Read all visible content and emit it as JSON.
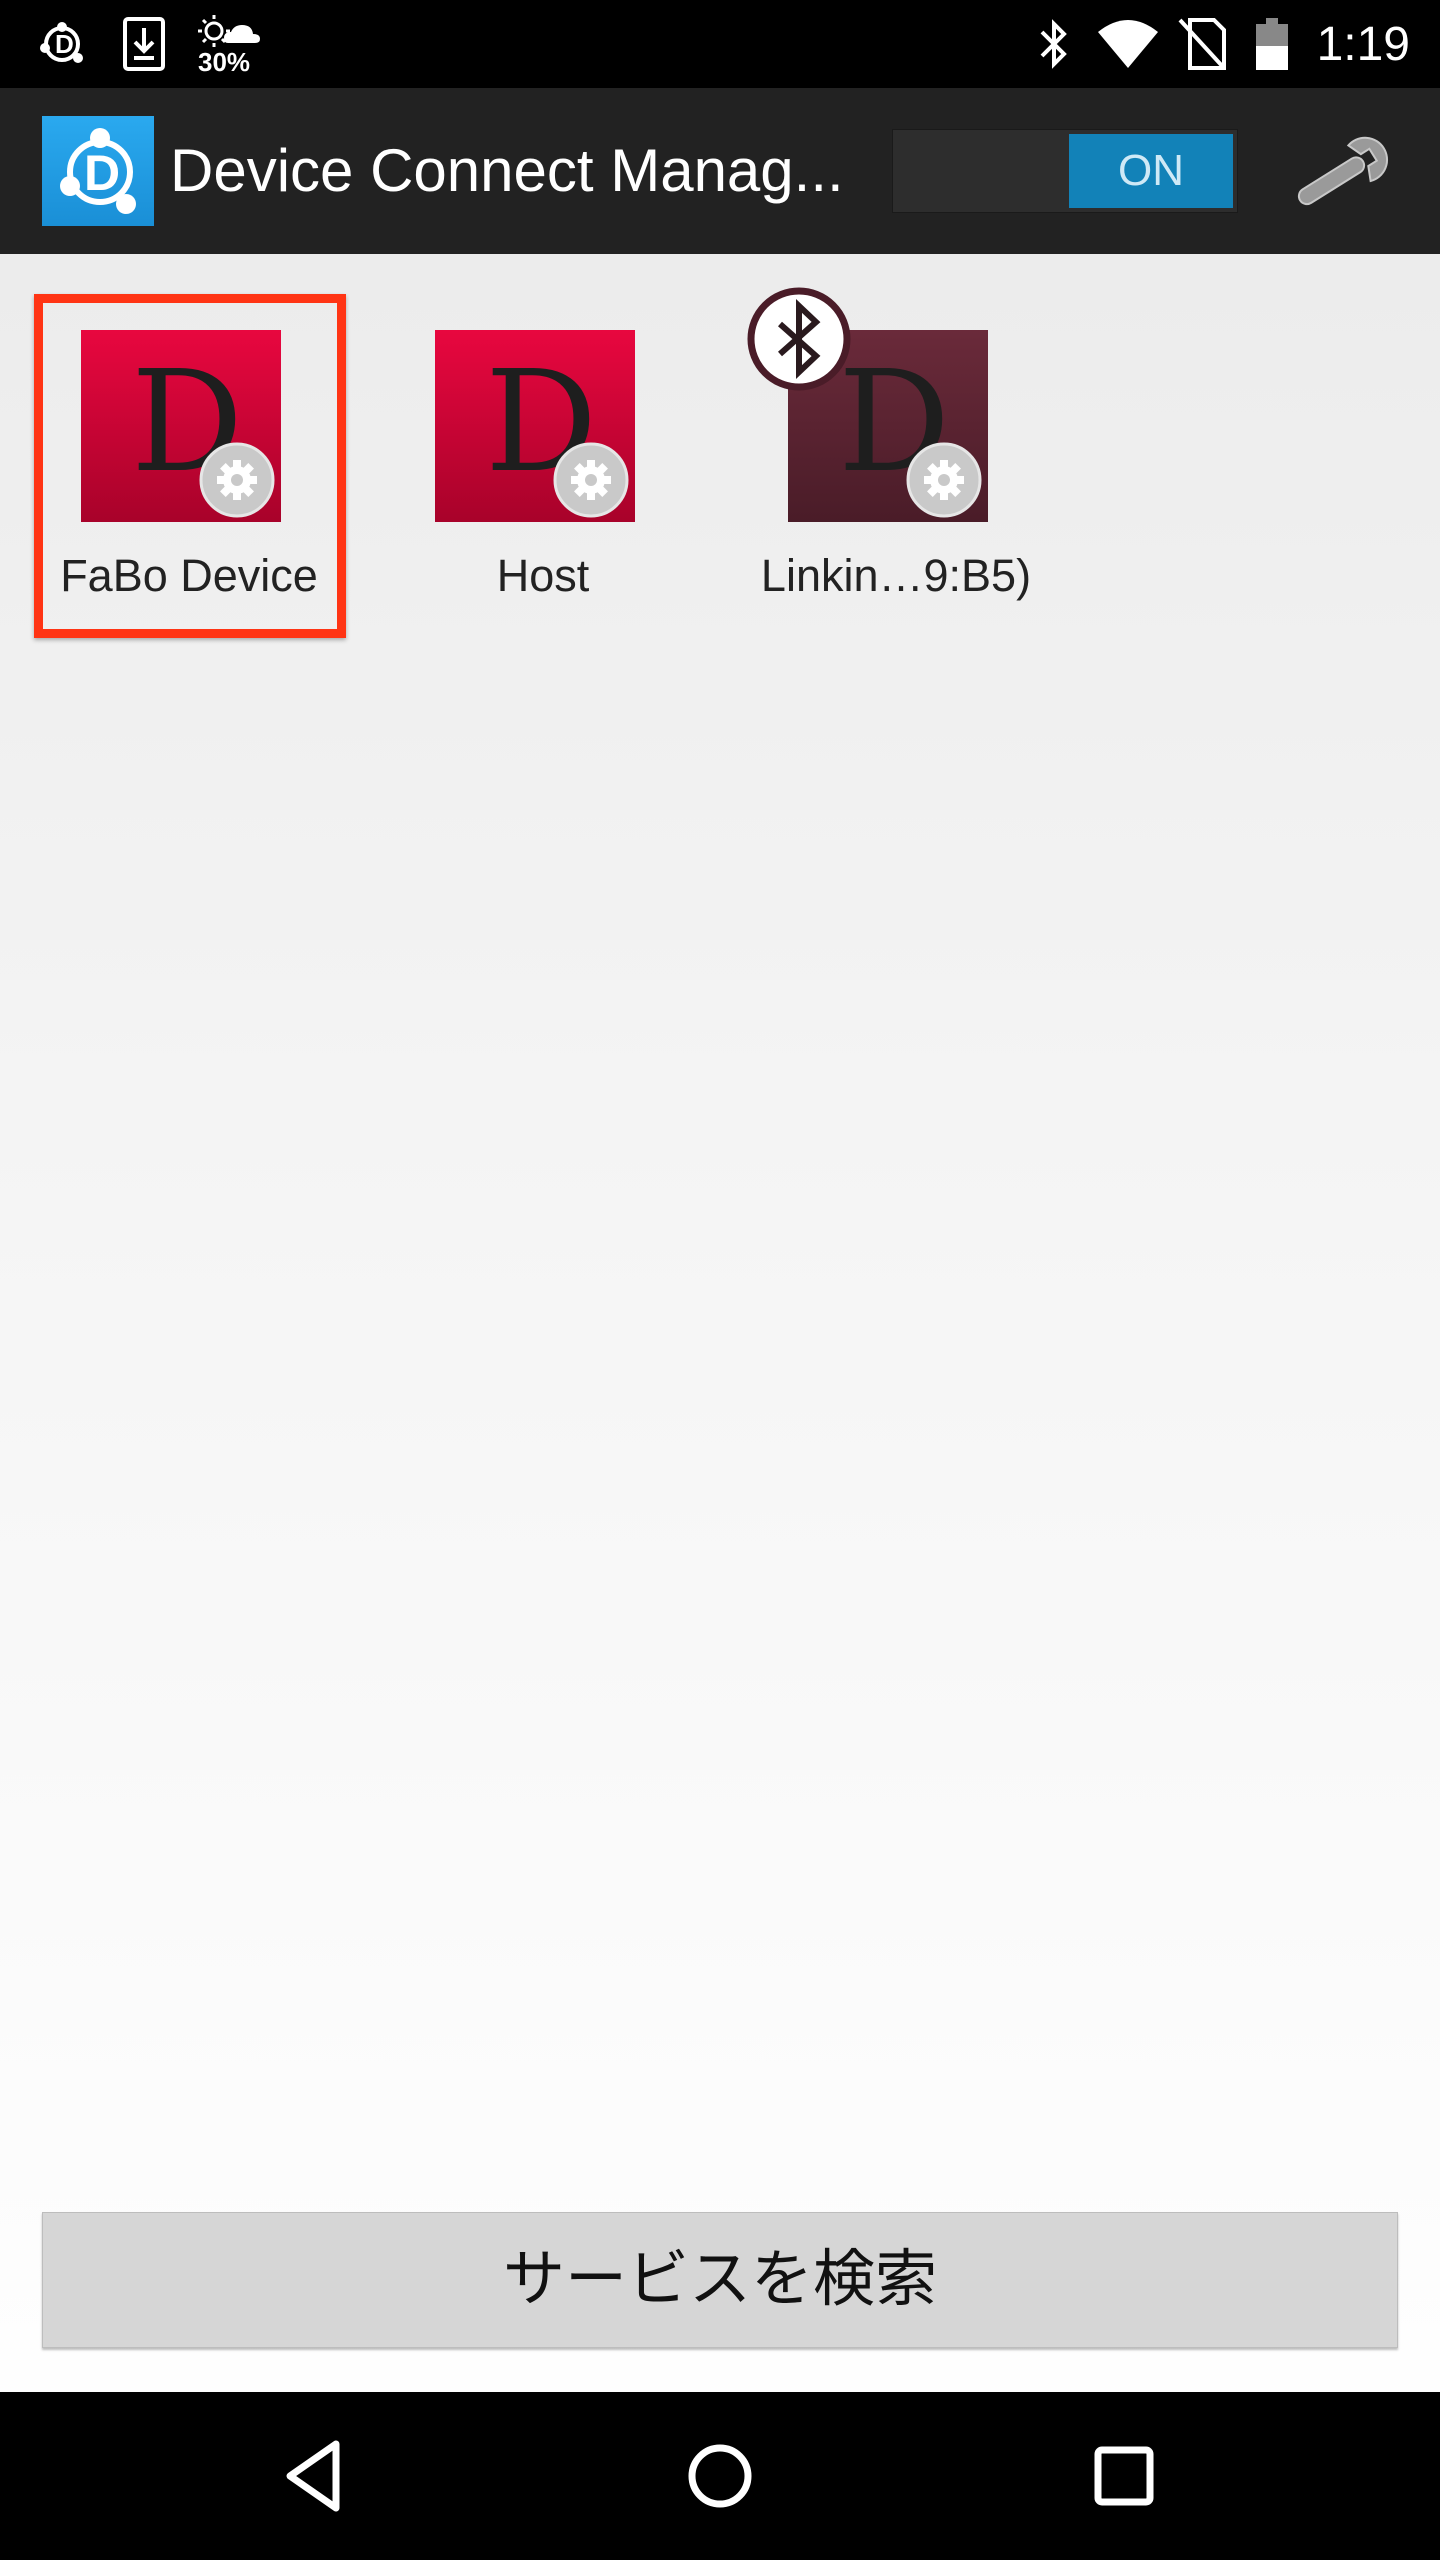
{
  "status_bar": {
    "time": "1:19",
    "weather_percent": "30%",
    "icons": [
      "device-connect-icon",
      "download-icon",
      "weather-icon",
      "bluetooth-icon",
      "wifi-icon",
      "no-sim-icon",
      "battery-icon"
    ]
  },
  "action_bar": {
    "title": "Device Connect Manag...",
    "toggle_label": "ON",
    "settings_icon": "wrench-icon"
  },
  "devices": [
    {
      "label": "FaBo Device",
      "icon": "device-plugin-icon",
      "selected": true
    },
    {
      "label": "Host",
      "icon": "device-plugin-icon",
      "selected": false
    },
    {
      "label": "Linkin…9:B5)",
      "icon": "device-plugin-icon",
      "badge": "bluetooth-icon",
      "selected": false
    }
  ],
  "search_button": {
    "label": "サービスを検索"
  },
  "nav_bar": {
    "items": [
      "back-icon",
      "home-icon",
      "recents-icon"
    ]
  },
  "colors": {
    "accent_toggle": "#1282b8",
    "plugin_red": "#d4073a",
    "plugin_dark": "#5a2434",
    "highlight": "#ff3414"
  }
}
